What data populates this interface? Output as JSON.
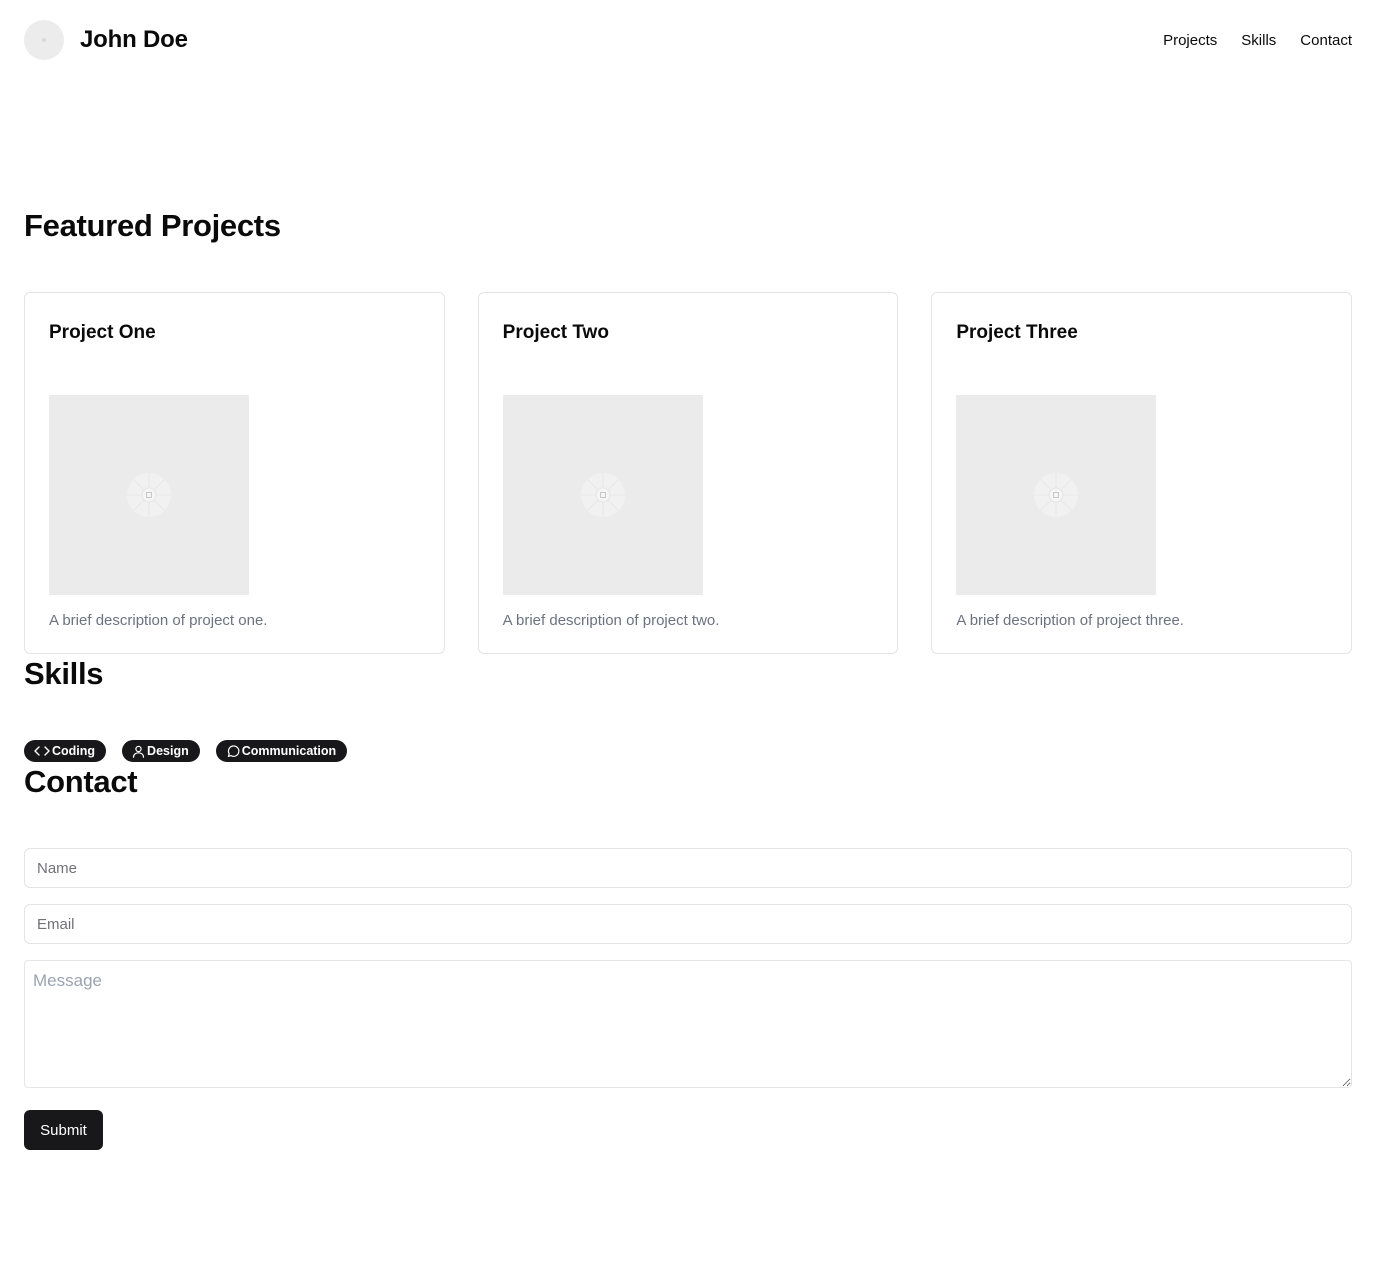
{
  "header": {
    "name": "John Doe",
    "nav": [
      {
        "label": "Projects"
      },
      {
        "label": "Skills"
      },
      {
        "label": "Contact"
      }
    ]
  },
  "projects": {
    "title": "Featured Projects",
    "items": [
      {
        "title": "Project One",
        "description": "A brief description of project one.",
        "image_icon": "image-placeholder-icon"
      },
      {
        "title": "Project Two",
        "description": "A brief description of project two.",
        "image_icon": "image-placeholder-icon"
      },
      {
        "title": "Project Three",
        "description": "A brief description of project three.",
        "image_icon": "image-placeholder-icon"
      }
    ]
  },
  "skills": {
    "title": "Skills",
    "items": [
      {
        "label": "Coding",
        "icon": "code-icon"
      },
      {
        "label": "Design",
        "icon": "user-icon"
      },
      {
        "label": "Communication",
        "icon": "message-circle-icon"
      }
    ]
  },
  "contact": {
    "title": "Contact",
    "name_placeholder": "Name",
    "email_placeholder": "Email",
    "message_placeholder": "Message",
    "submit_label": "Submit"
  },
  "colors": {
    "primary": "#18181b",
    "muted_text": "#6b7280",
    "border": "#e4e4e7",
    "placeholder_bg": "#ebebeb"
  }
}
